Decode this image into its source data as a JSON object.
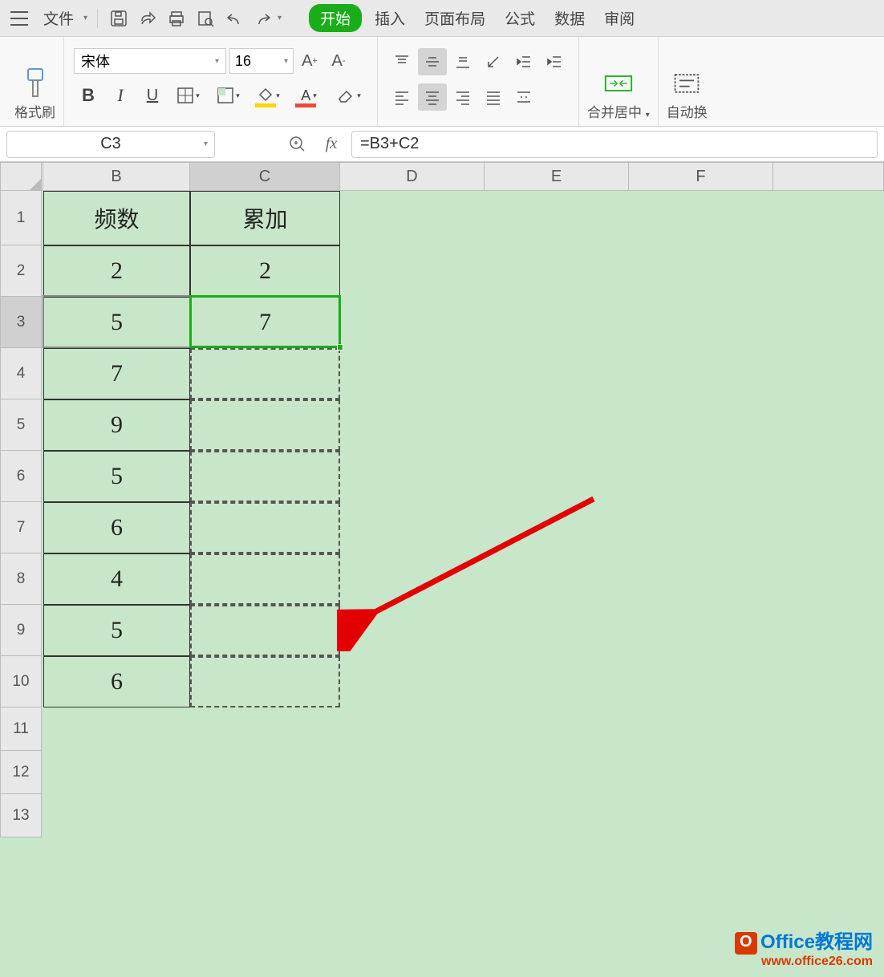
{
  "menu": {
    "file": "文件",
    "start": "开始",
    "insert": "插入",
    "layout": "页面布局",
    "formula": "公式",
    "data": "数据",
    "review": "审阅"
  },
  "ribbon": {
    "format_painter": "格式刷",
    "font_name": "宋体",
    "font_size": "16",
    "merge_center": "合并居中",
    "auto_wrap": "自动换"
  },
  "name_box": "C3",
  "formula": "=B3+C2",
  "columns": {
    "b": "B",
    "c": "C",
    "d": "D",
    "e": "E",
    "f": "F"
  },
  "rows": [
    "1",
    "2",
    "3",
    "4",
    "5",
    "6",
    "7",
    "8",
    "9",
    "10",
    "11",
    "12",
    "13"
  ],
  "headers": {
    "b": "频数",
    "c": "累加"
  },
  "col_b": [
    "2",
    "5",
    "7",
    "9",
    "5",
    "6",
    "4",
    "5",
    "6"
  ],
  "col_c": [
    "2",
    "7",
    "",
    "",
    "",
    "",
    "",
    "",
    ""
  ],
  "watermark": {
    "line1": "Office教程网",
    "line2": "www.office26.com"
  }
}
